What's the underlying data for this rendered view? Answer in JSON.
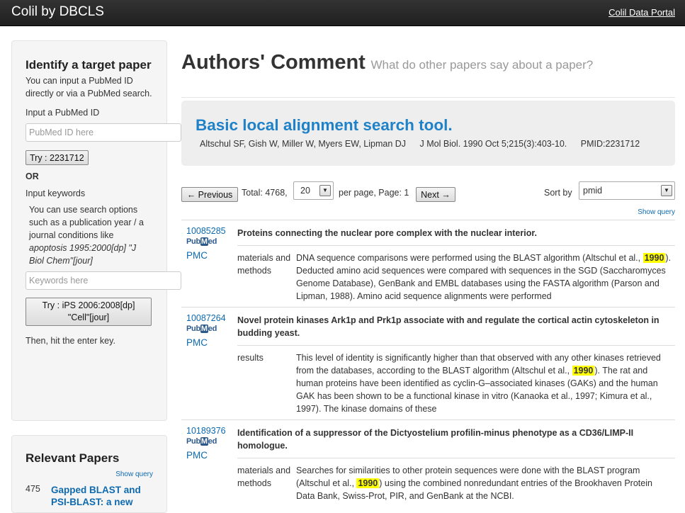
{
  "navbar": {
    "brand": "Colil by DBCLS",
    "portal_link": "Colil Data Portal"
  },
  "sidebar": {
    "heading": "Identify a target paper",
    "intro": "You can input a PubMed ID directly or via a PubMed search.",
    "pmid_label": "Input a PubMed ID",
    "pmid_placeholder": "PubMed ID here",
    "try_pmid_button": "Try : 2231712",
    "or_label": "OR",
    "keywords_label": "Input keywords",
    "keywords_help_prefix": "You can use search options such as a publication year / a journal conditions like ",
    "keywords_help_example": "apoptosis 1995:2000[dp] \"J Biol Chem\"[jour]",
    "keywords_placeholder": "Keywords here",
    "try_keywords_button": "Try : iPS 2006:2008[dp] \"Cell\"[jour]",
    "enter_hint": "Then, hit the enter key."
  },
  "relevant": {
    "title": "Relevant Papers",
    "show_query": "Show query",
    "items": [
      {
        "count": "475",
        "title": "Gapped BLAST and PSI-BLAST: a new"
      }
    ]
  },
  "header": {
    "title": "Authors' Comment",
    "subtitle": "What do other papers say about a paper?"
  },
  "paper": {
    "title": "Basic local alignment search tool.",
    "authors": "Altschul SF, Gish W, Miller W, Myers EW, Lipman DJ",
    "journal": "J Mol Biol. 1990 Oct 5;215(3):403-10.",
    "pmid": "PMID:2231712"
  },
  "controls": {
    "prev_button": "← Previous",
    "total_text": "Total: 4768,",
    "per_page_value": "20",
    "per_page_text": "per page, Page: 1",
    "next_button": "Next →",
    "sort_label": "Sort by",
    "sort_value": "pmid",
    "show_query": "Show query"
  },
  "pubmed_badge": {
    "pub": "Pub",
    "m": "M",
    "ed": "ed"
  },
  "results": [
    {
      "pmid": "10085285",
      "pmc": "PMC",
      "title": "Proteins connecting the nuclear pore complex with the nuclear interior.",
      "section": "materials and methods",
      "snippet_before": "DNA sequence comparisons were performed using the BLAST algorithm (Altschul et al., ",
      "highlight": "1990",
      "snippet_after": "). Deducted amino acid sequences were compared with sequences in the SGD (Saccharomyces Genome Database), GenBank and EMBL databases using the FASTA algorithm (Parson and Lipman, 1988). Amino acid sequence alignments were performed"
    },
    {
      "pmid": "10087264",
      "pmc": "PMC",
      "title": "Novel protein kinases Ark1p and Prk1p associate with and regulate the cortical actin cytoskeleton in budding yeast.",
      "section": "results",
      "snippet_before": "This level of identity is significantly higher than that observed with any other kinases retrieved from the databases, according to the BLAST algorithm (Altschul et al., ",
      "highlight": "1990",
      "snippet_after": "). The rat and human proteins have been identified as cyclin-G–associated kinases (GAKs) and the human GAK has been shown to be a functional kinase in vitro (Kanaoka et al., 1997; Kimura et al., 1997). The kinase domains of these"
    },
    {
      "pmid": "10189376",
      "pmc": "PMC",
      "title": "Identification of a suppressor of the Dictyostelium profilin-minus phenotype as a CD36/LIMP-II homologue.",
      "section": "materials and methods",
      "snippet_before": "Searches for similarities to other protein sequences were done with the BLAST program (Altschul et al., ",
      "highlight": "1990",
      "snippet_after": ") using the combined nonredundant entries of the Brookhaven Protein Data Bank, Swiss-Prot, PIR, and GenBank at the NCBI."
    }
  ]
}
